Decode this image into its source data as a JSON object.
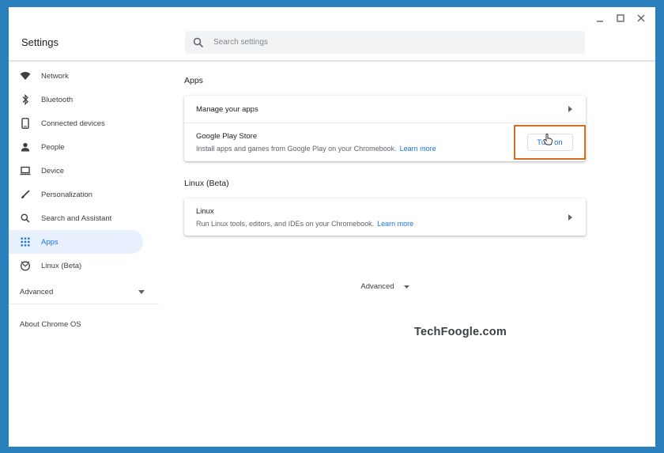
{
  "app": {
    "title": "Settings"
  },
  "search": {
    "placeholder": "Search settings"
  },
  "sidebar": {
    "items": [
      {
        "label": "Network",
        "icon": "wifi-icon"
      },
      {
        "label": "Bluetooth",
        "icon": "bluetooth-icon"
      },
      {
        "label": "Connected devices",
        "icon": "phone-icon"
      },
      {
        "label": "People",
        "icon": "person-icon"
      },
      {
        "label": "Device",
        "icon": "laptop-icon"
      },
      {
        "label": "Personalization",
        "icon": "brush-icon"
      },
      {
        "label": "Search and Assistant",
        "icon": "search-icon"
      },
      {
        "label": "Apps",
        "icon": "apps-grid-icon",
        "active": true
      },
      {
        "label": "Linux (Beta)",
        "icon": "linux-icon"
      }
    ],
    "advanced_label": "Advanced",
    "about_label": "About Chrome OS"
  },
  "main": {
    "apps_section": {
      "title": "Apps",
      "manage_label": "Manage your apps",
      "play_store": {
        "title": "Google Play Store",
        "description": "Install apps and games from Google Play on your Chromebook.",
        "learn_more": "Learn more",
        "button_label": "Turn on"
      }
    },
    "linux_section": {
      "title": "Linux (Beta)",
      "row_title": "Linux",
      "description": "Run Linux tools, editors, and IDEs on your Chromebook.",
      "learn_more": "Learn more"
    },
    "advanced_label": "Advanced"
  },
  "watermark": "TechFoogle.com",
  "colors": {
    "accent": "#1a73e8",
    "highlight_box": "#d46f22",
    "active_bg": "#e8f0fe",
    "desktop": "#2a7fbd"
  }
}
